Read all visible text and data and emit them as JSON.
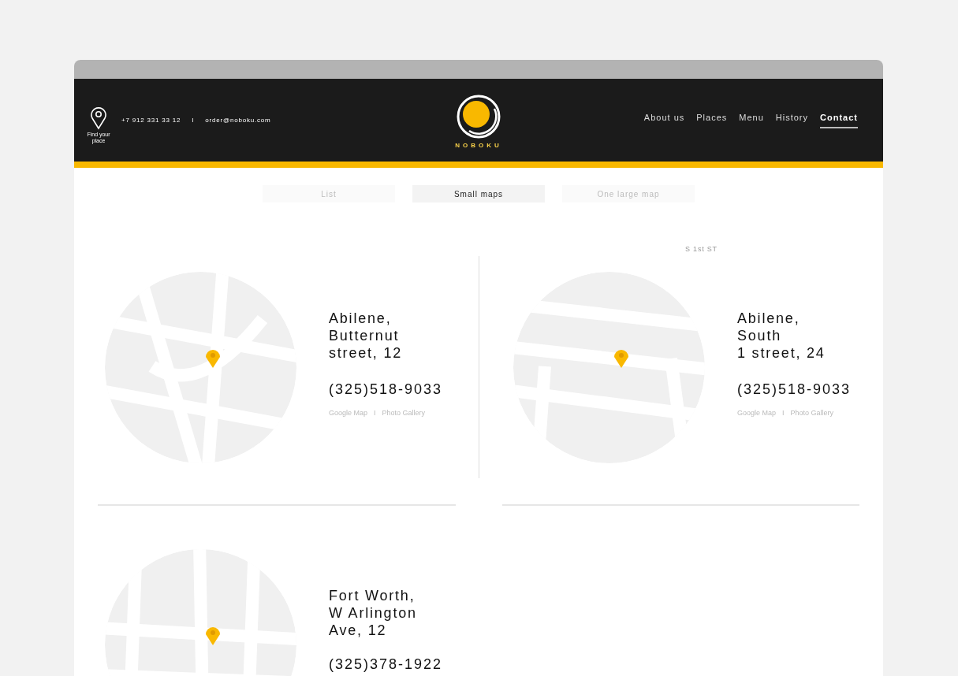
{
  "header": {
    "find_place": "Find your place",
    "phone": "+7 912 331 33 12",
    "separator": "I",
    "email": "order@noboku.com",
    "brand": "NOBOKU",
    "nav": [
      {
        "label": "About us",
        "selected": false
      },
      {
        "label": "Places",
        "selected": false
      },
      {
        "label": "Menu",
        "selected": false
      },
      {
        "label": "History",
        "selected": false
      },
      {
        "label": "Contact",
        "selected": true
      }
    ]
  },
  "view_tabs": [
    {
      "label": "List",
      "selected": false
    },
    {
      "label": "Small maps",
      "selected": true
    },
    {
      "label": "One large map",
      "selected": false
    }
  ],
  "locations": [
    {
      "map": {
        "kind": "picture"
      },
      "address_lines": [
        "Abilene,",
        "Butternut",
        "street, 12"
      ],
      "phone": "(325)518-9033",
      "links": [
        "Google Map",
        "Photo Gallery"
      ],
      "link_separator": "I"
    },
    {
      "map": {
        "kind": "picture"
      },
      "street_label": "S 1st ST",
      "address_lines": [
        "Abilene,",
        "South",
        "1 street, 24"
      ],
      "phone": "(325)518-9033",
      "links": [
        "Google Map",
        "Photo Gallery"
      ],
      "link_separator": "I"
    },
    {
      "map": {
        "kind": "picture"
      },
      "address_lines": [
        "Fort Worth,",
        "W Arlington",
        "Ave, 12"
      ],
      "phone": "(325)378-1922"
    }
  ]
}
